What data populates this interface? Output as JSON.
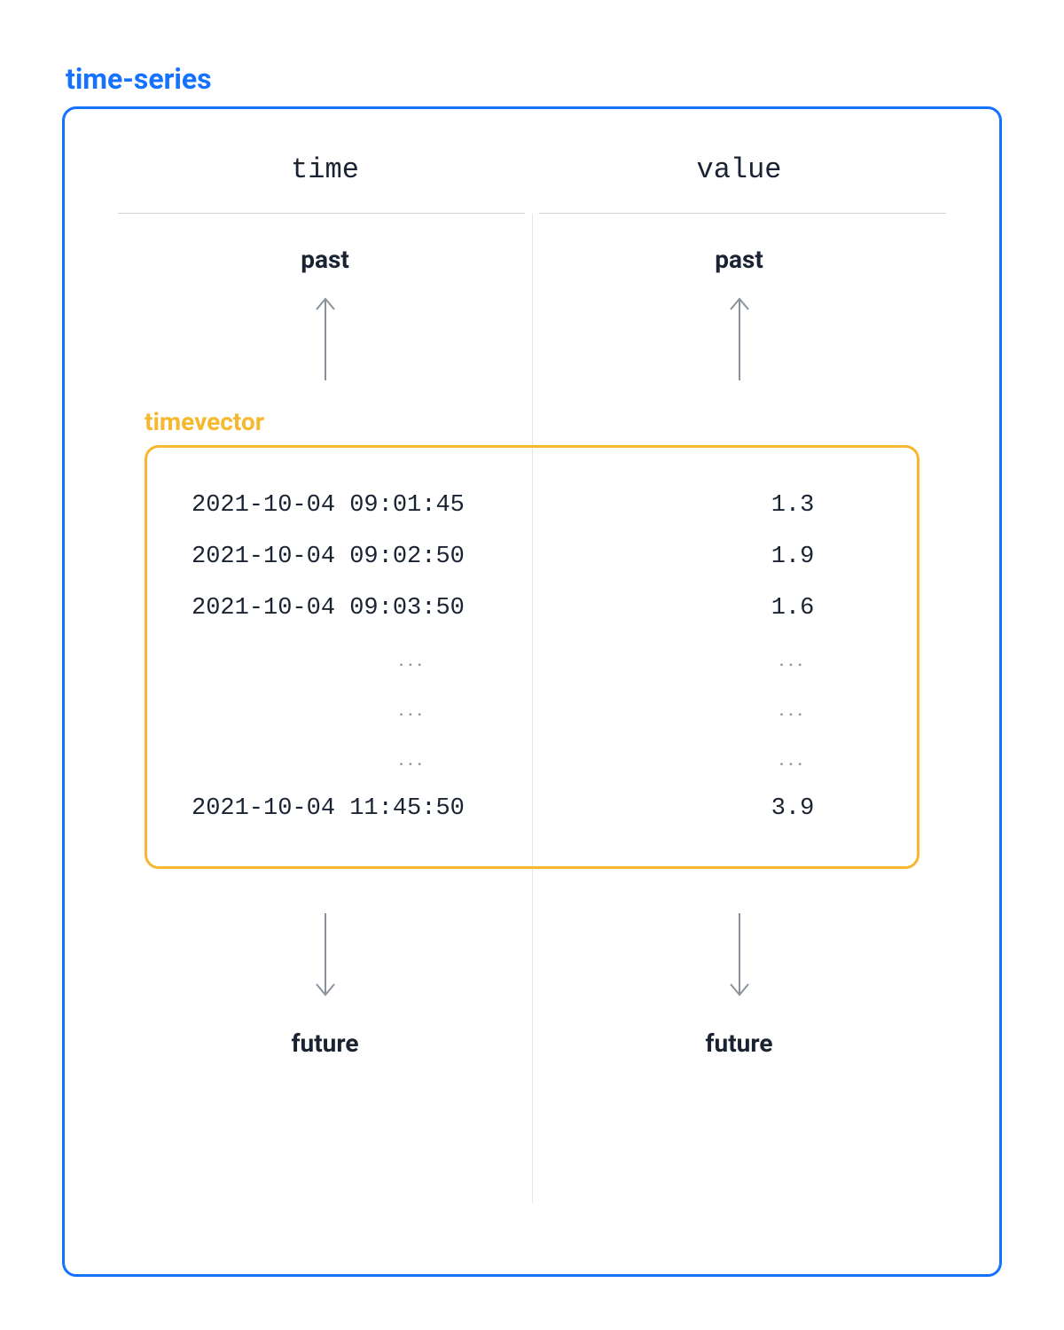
{
  "outer": {
    "title": "time-series",
    "headers": {
      "time": "time",
      "value": "value"
    },
    "past_label": "past",
    "future_label": "future"
  },
  "inner": {
    "title": "timevector",
    "rows": [
      {
        "time": "2021-10-04 09:01:45",
        "value": "1.3"
      },
      {
        "time": "2021-10-04 09:02:50",
        "value": "1.9"
      },
      {
        "time": "2021-10-04 09:03:50",
        "value": "1.6"
      }
    ],
    "ellipsis": "...",
    "last_row": {
      "time": "2021-10-04 11:45:50",
      "value": "3.9"
    }
  }
}
